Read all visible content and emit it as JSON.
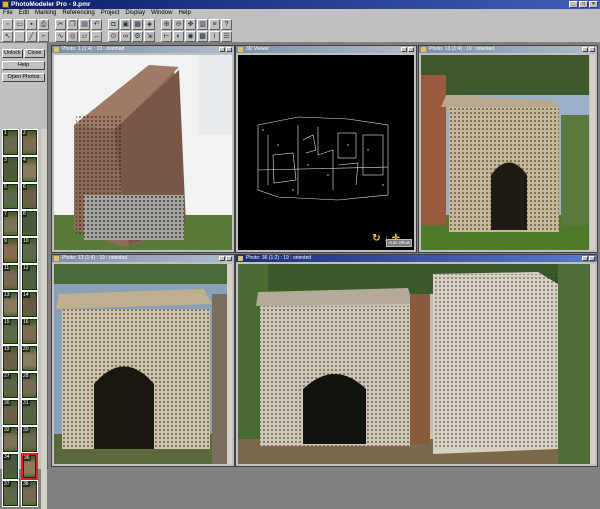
{
  "window": {
    "title": "PhotoModeler Pro - 9.pmr",
    "min": "_",
    "max": "□",
    "close": "×"
  },
  "menu": [
    "File",
    "Edit",
    "Marking",
    "Referencing",
    "Project",
    "Display",
    "Window",
    "Help"
  ],
  "toolbar": {
    "row1": [
      "new-icon",
      "open-icon",
      "save-icon",
      "print-icon",
      "cut-icon",
      "copy-icon",
      "paste-icon",
      "undo-icon",
      "camera-icon",
      "photo-icon",
      "table-icon",
      "3d-viewer-icon",
      "zoom-in-icon",
      "zoom-out-icon",
      "pan-icon",
      "point-table-icon",
      "line-table-icon",
      "help-icon"
    ],
    "row2": [
      "select-icon",
      "point-mode-icon",
      "line-mode-icon",
      "edge-mode-icon",
      "curve-mode-icon",
      "cylinder-icon",
      "surface-icon",
      "measure-icon",
      "reference-icon",
      "chain-icon",
      "process-icon",
      "scale-icon",
      "axes-icon",
      "orient-icon",
      "targets-icon",
      "grid-icon",
      "info-icon",
      "settings-icon"
    ]
  },
  "panel": {
    "unlock": "Unlock",
    "close": "Close",
    "help": "Help",
    "open_photos": "Open Photos",
    "thumbs": [
      {
        "n": "1",
        "c": "#6b6a4f"
      },
      {
        "n": "2",
        "c": "#7a6b52"
      },
      {
        "n": "3",
        "c": "#4e5a3a"
      },
      {
        "n": "4",
        "c": "#8a7a60"
      },
      {
        "n": "5",
        "c": "#5a6a48"
      },
      {
        "n": "6",
        "c": "#6f5e48"
      },
      {
        "n": "7",
        "c": "#7b7258"
      },
      {
        "n": "8",
        "c": "#4a5a3e"
      },
      {
        "n": "9",
        "c": "#8a6a50"
      },
      {
        "n": "10",
        "c": "#5e6a4c"
      },
      {
        "n": "11",
        "c": "#7a6a54"
      },
      {
        "n": "12",
        "c": "#4e5e40"
      },
      {
        "n": "13",
        "c": "#8a7860"
      },
      {
        "n": "14",
        "c": "#6a5a44"
      },
      {
        "n": "15",
        "c": "#5c6a4e"
      },
      {
        "n": "16",
        "c": "#7e6c52"
      },
      {
        "n": "19",
        "c": "#6a6248"
      },
      {
        "n": "20",
        "c": "#8a7c62"
      },
      {
        "n": "27",
        "c": "#5a6646"
      },
      {
        "n": "28",
        "c": "#7a6c54"
      },
      {
        "n": "30",
        "c": "#6e5e4a"
      },
      {
        "n": "31",
        "c": "#566244"
      },
      {
        "n": "32",
        "c": "#807058"
      },
      {
        "n": "33",
        "c": "#6c6a50"
      },
      {
        "n": "34",
        "c": "#4e5a40"
      },
      {
        "n": "36",
        "c": "#8c7a5c"
      },
      {
        "n": "37",
        "c": "#5c6848"
      },
      {
        "n": "38",
        "c": "#766a52"
      }
    ],
    "selected": "36"
  },
  "windows": {
    "w1": {
      "title": "Photo: 1 (1:4) : 19 : oriented"
    },
    "w2": {
      "title": "3D Viewer",
      "label": "Auto Show"
    },
    "w3": {
      "title": "Photo: 13 (1:4) : 19 : oriented"
    },
    "w4": {
      "title": "Photo: 13 (1:4) : 19 : oriented"
    },
    "w5": {
      "title": "Photo: 36 (1:2) : 19 : oriented"
    }
  },
  "colors": {
    "accent": "#0a1f6a",
    "mark": "#1a1a1a",
    "selected_thumb": "#dd2222",
    "viewer_icons": "#f0c020"
  }
}
